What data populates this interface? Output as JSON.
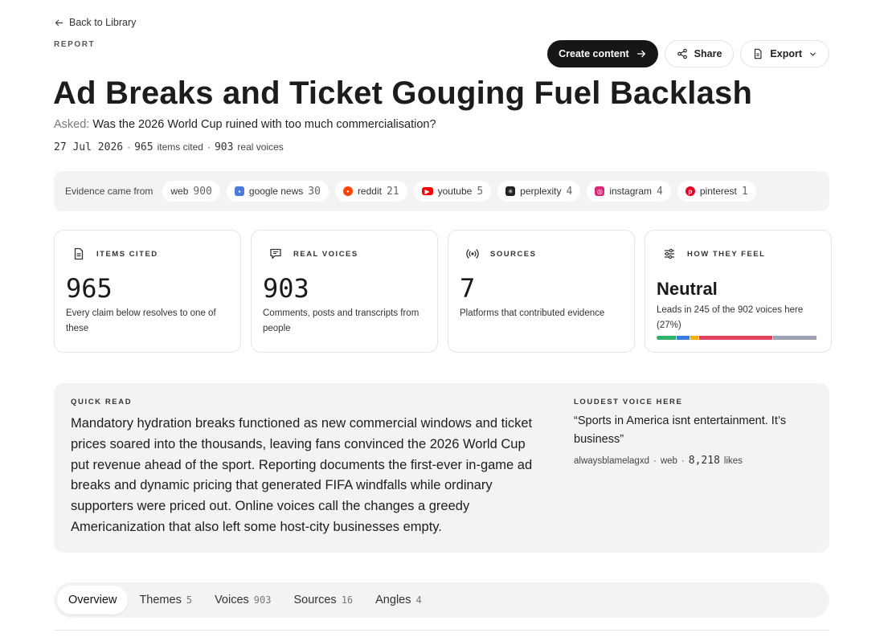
{
  "nav": {
    "back_label": "Back to Library",
    "eyebrow": "REPORT"
  },
  "actions": {
    "create_label": "Create content",
    "share_label": "Share",
    "export_label": "Export"
  },
  "report": {
    "title": "Ad Breaks and Ticket Gouging Fuel Backlash",
    "asked_label": "Asked:",
    "asked_text": "Was the 2026 World Cup ruined with too much commercialisation?",
    "date": "27 Jul 2026",
    "items_count": "965",
    "items_label": "items cited",
    "voices_count": "903",
    "voices_label": "real voices"
  },
  "evidence": {
    "label": "Evidence came from",
    "sources": [
      {
        "name": "web",
        "count": "900",
        "icon": "web-icon"
      },
      {
        "name": "google news",
        "count": "30",
        "icon": "google-news-icon",
        "color": "#4a7bd8"
      },
      {
        "name": "reddit",
        "count": "21",
        "icon": "reddit-icon",
        "color": "#ff4500"
      },
      {
        "name": "youtube",
        "count": "5",
        "icon": "youtube-icon",
        "color": "#ff0000"
      },
      {
        "name": "perplexity",
        "count": "4",
        "icon": "perplexity-icon",
        "color": "#222222"
      },
      {
        "name": "instagram",
        "count": "4",
        "icon": "instagram-icon",
        "color": "#d62976"
      },
      {
        "name": "pinterest",
        "count": "1",
        "icon": "pinterest-icon",
        "color": "#e60023"
      }
    ]
  },
  "stats": {
    "items": {
      "label": "ITEMS CITED",
      "value": "965",
      "desc": "Every claim below resolves to one of these"
    },
    "voices": {
      "label": "REAL VOICES",
      "value": "903",
      "desc": "Comments, posts and transcripts from people"
    },
    "sources": {
      "label": "SOURCES",
      "value": "7",
      "desc": "Platforms that contributed evidence"
    },
    "feel": {
      "label": "HOW THEY FEEL",
      "value": "Neutral",
      "desc": "Leads in 245 of the 902 voices here (27%)",
      "segments": [
        {
          "name": "positive",
          "share": 0.12,
          "color": "#2fb36a"
        },
        {
          "name": "mixed",
          "share": 0.08,
          "color": "#3b7be0"
        },
        {
          "name": "curious",
          "share": 0.05,
          "color": "#f0b400"
        },
        {
          "name": "negative",
          "share": 0.46,
          "color": "#e0425e"
        },
        {
          "name": "neutral",
          "share": 0.27,
          "color": "#9ea3b4"
        }
      ]
    }
  },
  "quick_read": {
    "label": "QUICK READ",
    "text": "Mandatory hydration breaks functioned as new commercial windows and ticket prices soared into the thousands, leaving fans convinced the 2026 World Cup put revenue ahead of the sport. Reporting documents the first-ever in-game ad breaks and dynamic pricing that generated FIFA windfalls while ordinary supporters were priced out. Online voices call the changes a greedy Americanization that also left some host-city businesses empty."
  },
  "loudest": {
    "label": "LOUDEST VOICE HERE",
    "quote": "“Sports in America isnt entertainment. It’s business”",
    "author": "alwaysblamelagxd",
    "source": "web",
    "likes": "8,218",
    "likes_label": "likes"
  },
  "tabs": [
    {
      "label": "Overview",
      "count": ""
    },
    {
      "label": "Themes",
      "count": "5"
    },
    {
      "label": "Voices",
      "count": "903"
    },
    {
      "label": "Sources",
      "count": "16"
    },
    {
      "label": "Angles",
      "count": "4"
    }
  ]
}
